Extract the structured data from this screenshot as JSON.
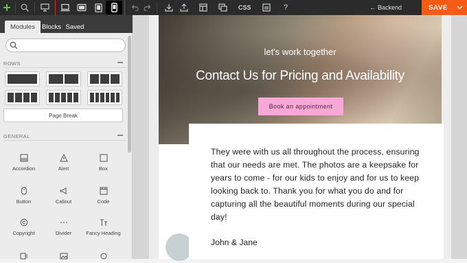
{
  "toolbar": {
    "css_label": "CSS",
    "backend_label": "Backend",
    "save_label": "SAVE",
    "icons": [
      "plus-icon",
      "zoom-icon",
      "desktop-icon",
      "laptop-icon",
      "tablet-landscape-icon",
      "tablet-icon",
      "phone-icon",
      "undo-icon",
      "redo-icon",
      "import-icon",
      "export-icon",
      "layout-icon",
      "duplicate-icon",
      "css-icon",
      "code-icon",
      "help-icon"
    ],
    "accent_color": "#f55b14"
  },
  "sidebar": {
    "tabs": [
      {
        "label": "Modules",
        "active": true
      },
      {
        "label": "Blocks",
        "active": false
      },
      {
        "label": "Saved",
        "active": false
      }
    ],
    "search_placeholder": "",
    "rows_heading": "ROWS",
    "page_break_label": "Page Break",
    "general_heading": "GENERAL",
    "modules": [
      {
        "label": "Accordion",
        "icon": "accordion-icon"
      },
      {
        "label": "Alert",
        "icon": "alert-icon"
      },
      {
        "label": "Box",
        "icon": "box-icon"
      },
      {
        "label": "Button",
        "icon": "button-icon"
      },
      {
        "label": "Callout",
        "icon": "callout-icon"
      },
      {
        "label": "Code",
        "icon": "code-icon"
      },
      {
        "label": "Copyright",
        "icon": "copyright-icon"
      },
      {
        "label": "Divider",
        "icon": "divider-icon"
      },
      {
        "label": "Fancy Heading",
        "icon": "fancy-heading-icon"
      }
    ]
  },
  "hero": {
    "subtitle": "let's work together",
    "title": "Contact Us for Pricing and Availability",
    "button_label": "Book an appointment",
    "button_color": "#f7a8d6"
  },
  "testimonial": {
    "text": "They were with us all throughout the process, ensuring that our needs are met. The photos are a keepsake for years to come - for our kids to enjoy and for us to keep looking back to. Thank you for what you do and for capturing all the beautiful moments during our special day!",
    "signature": "John & Jane"
  }
}
